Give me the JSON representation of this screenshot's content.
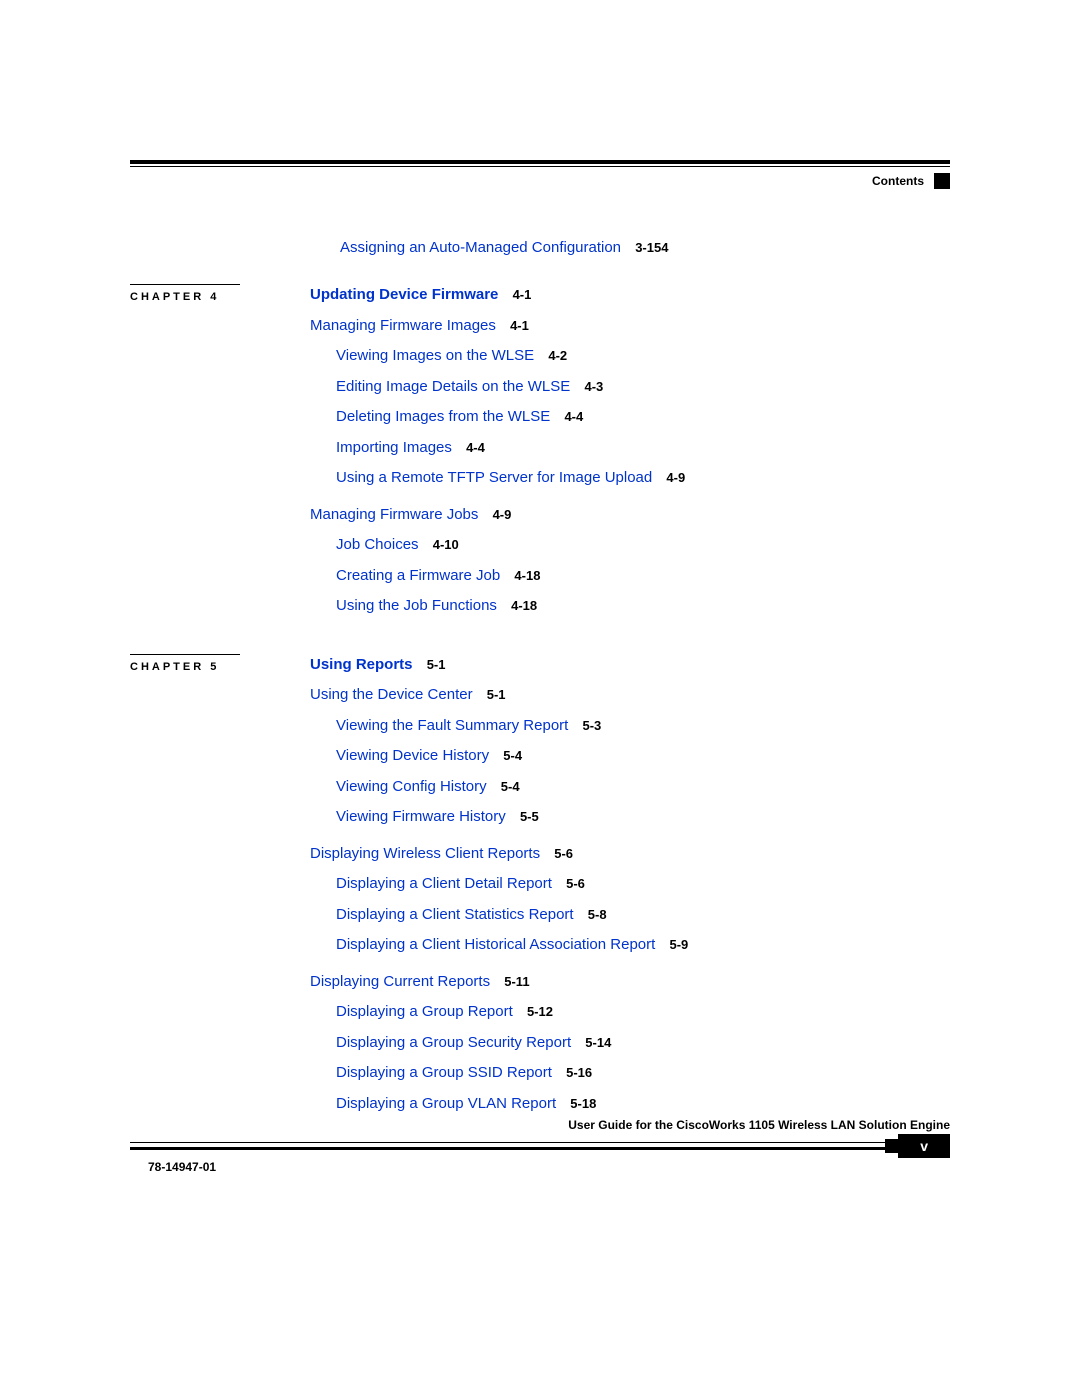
{
  "header": {
    "contents": "Contents"
  },
  "orphan": {
    "title": "Assigning an Auto-Managed Configuration",
    "page": "3-154"
  },
  "chapter4": {
    "label": "CHAPTER 4",
    "title": "Updating Device Firmware",
    "titlePage": "4-1",
    "s1": {
      "title": "Managing Firmware Images",
      "page": "4-1"
    },
    "s1a": {
      "title": "Viewing Images on the WLSE",
      "page": "4-2"
    },
    "s1b": {
      "title": "Editing Image Details on the WLSE",
      "page": "4-3"
    },
    "s1c": {
      "title": "Deleting Images from the WLSE",
      "page": "4-4"
    },
    "s1d": {
      "title": "Importing Images",
      "page": "4-4"
    },
    "s1e": {
      "title": "Using a Remote TFTP Server for Image Upload",
      "page": "4-9"
    },
    "s2": {
      "title": "Managing Firmware Jobs",
      "page": "4-9"
    },
    "s2a": {
      "title": "Job Choices",
      "page": "4-10"
    },
    "s2b": {
      "title": "Creating a Firmware Job",
      "page": "4-18"
    },
    "s2c": {
      "title": "Using the Job Functions",
      "page": "4-18"
    }
  },
  "chapter5": {
    "label": "CHAPTER 5",
    "title": "Using Reports",
    "titlePage": "5-1",
    "s1": {
      "title": "Using the Device Center",
      "page": "5-1"
    },
    "s1a": {
      "title": "Viewing the Fault Summary Report",
      "page": "5-3"
    },
    "s1b": {
      "title": "Viewing Device History",
      "page": "5-4"
    },
    "s1c": {
      "title": "Viewing Config History",
      "page": "5-4"
    },
    "s1d": {
      "title": "Viewing Firmware History",
      "page": "5-5"
    },
    "s2": {
      "title": "Displaying Wireless Client Reports",
      "page": "5-6"
    },
    "s2a": {
      "title": "Displaying a Client Detail Report",
      "page": "5-6"
    },
    "s2b": {
      "title": "Displaying a Client Statistics Report",
      "page": "5-8"
    },
    "s2c": {
      "title": "Displaying a Client Historical Association Report",
      "page": "5-9"
    },
    "s3": {
      "title": "Displaying Current Reports",
      "page": "5-11"
    },
    "s3a": {
      "title": "Displaying a Group Report",
      "page": "5-12"
    },
    "s3b": {
      "title": "Displaying a Group Security Report",
      "page": "5-14"
    },
    "s3c": {
      "title": "Displaying a Group SSID Report",
      "page": "5-16"
    },
    "s3d": {
      "title": "Displaying a Group VLAN Report",
      "page": "5-18"
    }
  },
  "footer": {
    "guide": "User Guide for the CiscoWorks 1105 Wireless LAN Solution Engine",
    "docnum": "78-14947-01",
    "pagenum": "v"
  }
}
